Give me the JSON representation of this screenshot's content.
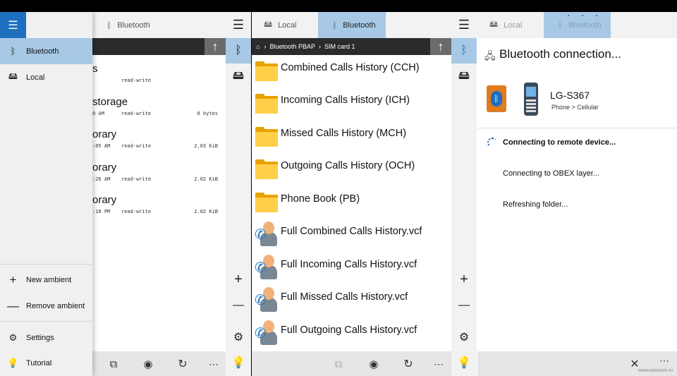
{
  "left_panel": {
    "tab_label": "Bluetooth",
    "drawer": {
      "items": [
        {
          "label": "Bluetooth",
          "icon": "bluetooth-icon"
        },
        {
          "label": "Local",
          "icon": "local-drive-icon"
        }
      ],
      "new_ambient": "New ambient",
      "remove_ambient": "Remove ambient",
      "settings": "Settings",
      "tutorial": "Tutorial"
    },
    "files": [
      {
        "name": "s",
        "time": "",
        "perm": "read-write",
        "size": ""
      },
      {
        "name": "storage",
        "time": "0 AM",
        "perm": "read-write",
        "size": "0 bytes"
      },
      {
        "name": "orary",
        "time": ":05 AM",
        "perm": "read-write",
        "size": "2.03 KiB"
      },
      {
        "name": "orary",
        "time": ":26 AM",
        "perm": "read-write",
        "size": "2.02 KiB"
      },
      {
        "name": "orary",
        "time": ":18 PM",
        "perm": "read-write",
        "size": "2.02 KiB"
      }
    ]
  },
  "middle_panel": {
    "tabs": [
      {
        "label": "Local",
        "selected": false
      },
      {
        "label": "Bluetooth",
        "selected": true
      }
    ],
    "breadcrumb": [
      "Bluetooth PBAP",
      "SIM card 1"
    ],
    "items": [
      {
        "name": "Combined Calls History (CCH)",
        "type": "folder"
      },
      {
        "name": "Incoming Calls History (ICH)",
        "type": "folder"
      },
      {
        "name": "Missed Calls History (MCH)",
        "type": "folder"
      },
      {
        "name": "Outgoing Calls History (OCH)",
        "type": "folder"
      },
      {
        "name": "Phone Book (PB)",
        "type": "folder"
      },
      {
        "name": "Full Combined Calls History.vcf",
        "type": "contact"
      },
      {
        "name": "Full Incoming Calls History.vcf",
        "type": "contact"
      },
      {
        "name": "Full Missed Calls History.vcf",
        "type": "contact"
      },
      {
        "name": "Full Outgoing Calls History.vcf",
        "type": "contact"
      }
    ]
  },
  "right_panel": {
    "tabs": [
      {
        "label": "Local",
        "selected": false
      },
      {
        "label": "Bluetooth",
        "selected": true
      }
    ],
    "title": "Bluetooth connection...",
    "device_name": "LG-S367",
    "device_path": "Phone > Cellular",
    "status_current": "Connecting to remote device...",
    "status_next_1": "Connecting to OBEX layer...",
    "status_next_2": "Refreshing folder..."
  },
  "colors": {
    "accent": "#1e6fbf",
    "selected_tab": "#a7c9e6",
    "folder": "#ffcf4a"
  },
  "watermark": "www.wincore.ru"
}
